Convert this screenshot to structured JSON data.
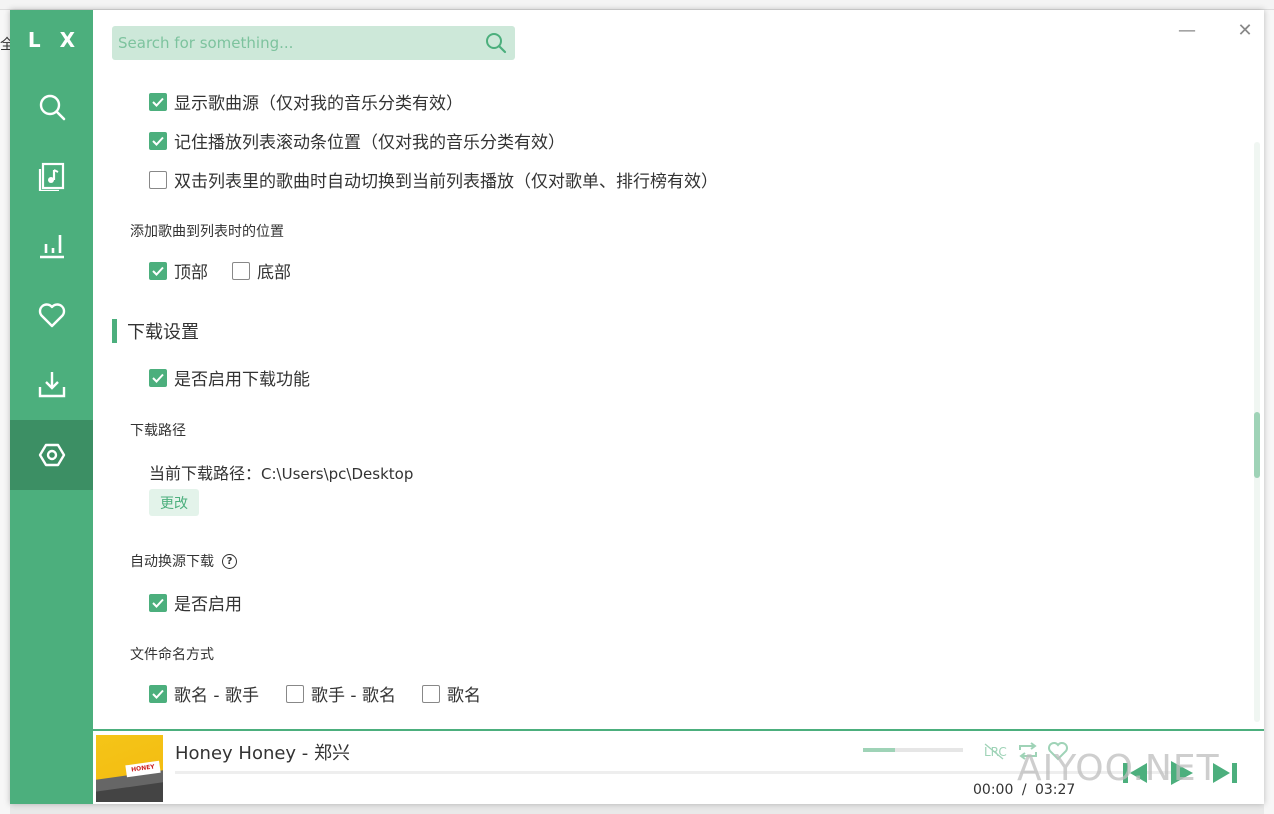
{
  "app": {
    "logo": "L X"
  },
  "background": {
    "left_char": "全"
  },
  "search": {
    "placeholder": "Search for something..."
  },
  "window_controls": {
    "minimize": "—",
    "close": "✕"
  },
  "settings": {
    "play_list": {
      "options": [
        {
          "label": "显示歌曲源（仅对我的音乐分类有效）",
          "checked": true
        },
        {
          "label": "记住播放列表滚动条位置（仅对我的音乐分类有效）",
          "checked": true
        },
        {
          "label": "双击列表里的歌曲时自动切换到当前列表播放（仅对歌单、排行榜有效）",
          "checked": false
        }
      ],
      "add_position_label": "添加歌曲到列表时的位置",
      "add_position_options": [
        {
          "label": "顶部",
          "checked": true
        },
        {
          "label": "底部",
          "checked": false
        }
      ]
    },
    "download": {
      "section_title": "下载设置",
      "enable_label": "是否启用下载功能",
      "enable_checked": true,
      "path_label": "下载路径",
      "current_path_prefix": "当前下载路径：",
      "current_path_value": "C:\\Users\\pc\\Desktop",
      "change_button": "更改",
      "auto_switch_label": "自动换源下载",
      "help_icon_text": "?",
      "auto_switch_option": "是否启用",
      "auto_switch_checked": true,
      "naming_label": "文件命名方式",
      "naming_options": [
        {
          "label": "歌名 - 歌手",
          "checked": true
        },
        {
          "label": "歌手 - 歌名",
          "checked": false
        },
        {
          "label": "歌名",
          "checked": false
        }
      ]
    }
  },
  "player": {
    "title": "Honey Honey - 郑兴",
    "current_time": "00:00",
    "separator": "/",
    "total_time": "03:27",
    "volume": 0.32,
    "lrc_label": "LRC",
    "cover_text": "HONEY"
  },
  "watermark": "AIYOO.NET",
  "colors": {
    "accent": "#4caf7d",
    "accent_dark": "#3c8f64",
    "search_bg": "#cde8d9"
  }
}
